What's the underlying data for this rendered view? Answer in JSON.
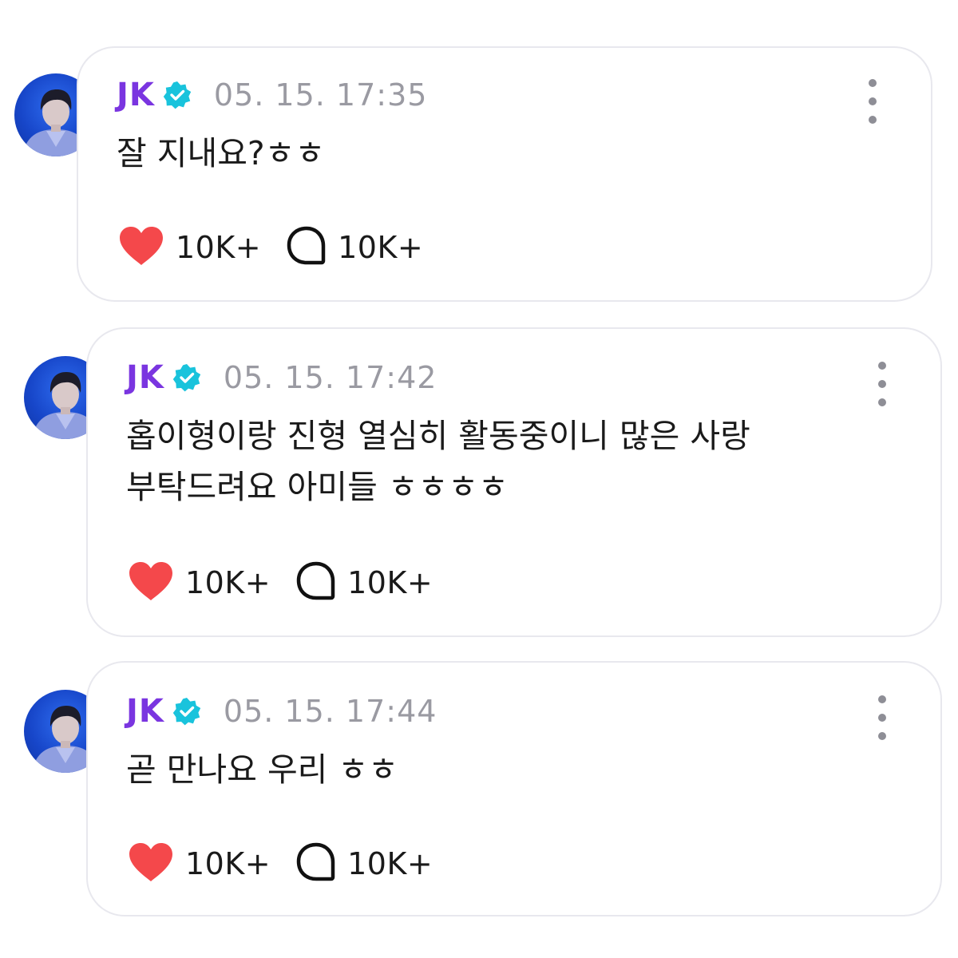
{
  "posts": [
    {
      "author": "JK",
      "time": "05. 15. 17:35",
      "message": "잘 지내요?ㅎㅎ",
      "likes": "10K+",
      "comments": "10K+"
    },
    {
      "author": "JK",
      "time": "05. 15. 17:42",
      "message": "홉이형이랑 진형 열심히 활동중이니 많은 사랑\n부탁드려요 아미들 ㅎㅎㅎㅎ",
      "likes": "10K+",
      "comments": "10K+"
    },
    {
      "author": "JK",
      "time": "05. 15. 17:44",
      "message": "곧 만나요 우리 ㅎㅎ",
      "likes": "10K+",
      "comments": "10K+"
    }
  ],
  "colors": {
    "author": "#7a35e0",
    "verified_badge": "#19c3dc",
    "like_heart": "#f4484b",
    "timestamp": "#9a9aa2"
  },
  "icons": {
    "verified": "verified-badge-icon",
    "like": "heart-icon",
    "comment": "comment-bubble-icon",
    "more": "more-vertical-icon"
  }
}
